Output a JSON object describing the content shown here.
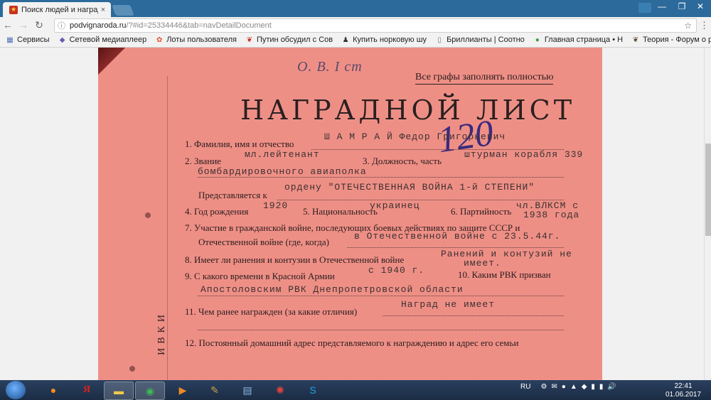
{
  "browser": {
    "tab_title": "Поиск людей и наградах",
    "tab_close": "×",
    "window_controls": [
      "—",
      "❐",
      "✕"
    ],
    "url_host": "podvignaroda.ru",
    "url_path": "/?#id=25334446&tab=navDetailDocument"
  },
  "bookmarks": [
    {
      "icon": "apps-grid-icon",
      "label": "Сервисы"
    },
    {
      "icon": "diamond-icon",
      "label": "Сетевой медиаплеер"
    },
    {
      "icon": "paw-icon",
      "label": "Лоты пользователя"
    },
    {
      "icon": "maple-leaf-icon",
      "label": "Путин обсудил с Сов"
    },
    {
      "icon": "person-icon",
      "label": "Купить норковую шу"
    },
    {
      "icon": "page-icon",
      "label": "Бриллианты | Соотно"
    },
    {
      "icon": "frog-icon",
      "label": "Главная страница • Н"
    },
    {
      "icon": "maple-leaf-icon",
      "label": "Теория - Форум о ры"
    }
  ],
  "document": {
    "top_handwritten": "О. В. I ст",
    "fill_all": "Все графы заполнять полностью",
    "heading": "НАГРАДНОЙ ЛИСТ",
    "handwritten_number": "120",
    "field1_label": "1. Фамилия, имя и отчество",
    "field1_value": "Ш А М Р А Й   Федор Григорьевич",
    "field2_label": "2. Звание",
    "field2_value": "мл.лейтенант",
    "field3_label": "3. Должность, часть",
    "field3_value": "штурман корабля 339",
    "field3_value2": "бомбардировочного авиаполка",
    "presented_label": "Представляется к",
    "presented_value": "ордену \"ОТЕЧЕСТВЕННАЯ ВОЙНА 1-й СТЕПЕНИ\"",
    "field4_label": "4. Год рождения",
    "field4_value": "1920",
    "field5_label": "5. Национальность",
    "field5_value": "украинец",
    "field6_label": "6. Партийность",
    "field6_value": "чл.ВЛКСМ с",
    "field6_value2": "1938 года",
    "field7_label": "7. Участие в гражданской войне, последующих боевых действиях по защите СССР и",
    "field7_label2": "Отечественной войне (где, когда)",
    "field7_value": "в Отечественной войне с 23.5.44г.",
    "field8_label": "8. Имеет ли ранения и контузии в Отечественной войне",
    "field8_value": "Ранений и контузий не",
    "field8_value2": "имеет.",
    "field9_label": "9. С какого времени в Красной Армии",
    "field9_value": "с 1940 г.",
    "field10_label": "10. Каким РВК призван",
    "field10_value": "Апостоловским РВК Днепропетровской области",
    "field11_label": "11. Чем ранее награжден  (за какие отличия)",
    "field11_value": "Наград не имеет",
    "field12_label": "12. Постоянный домашний адрес  представляемого  к  награждению  и  адрес  его  семьи",
    "side_text": "ИВКИ"
  },
  "taskbar": {
    "apps": [
      "firefox-icon",
      "yandex-icon",
      "explorer-icon",
      "chrome-icon",
      "media-player-icon",
      "gimp-icon",
      "calculator-icon",
      "picasa-icon",
      "skype-icon"
    ],
    "language": "RU",
    "time": "22:41",
    "date": "01.06.2017"
  }
}
